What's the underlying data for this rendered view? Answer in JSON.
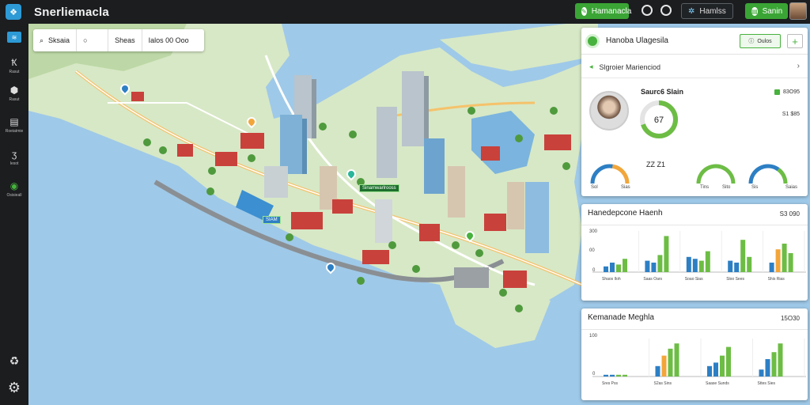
{
  "topbar": {
    "app_title": "Snerliemacla",
    "btn_primary": "Hamanacla",
    "btn_secondary": "Hamlss",
    "btn_third": "Sanin"
  },
  "rail": {
    "items": [
      {
        "glyph": "≋",
        "label": ""
      },
      {
        "glyph": "Ҟ",
        "label": "Rasut"
      },
      {
        "glyph": "⬢",
        "label": "Rasut"
      },
      {
        "glyph": "▤",
        "label": "Roeiatmie"
      },
      {
        "glyph": "ӡ",
        "label": "Iesot"
      },
      {
        "glyph": "◉",
        "label": "Osisieall"
      }
    ],
    "bottom_icons": [
      "recycle-icon",
      "gear-icon"
    ]
  },
  "search": {
    "seg1": "Sksaia",
    "seg2": "Sheas",
    "seg3": "Ialos 00 Ooo"
  },
  "map_chips": [
    "Sinamwarlrooss",
    "SIAM"
  ],
  "card1": {
    "title": "Hanoba Ulagesila",
    "btn_label": "Oulos",
    "subtitle": "Slgroier Marienciod",
    "person_name": "Saurc6 Slain",
    "stats": [
      "83O95",
      "S1 $85"
    ],
    "donut_value": "67",
    "donut_fraction": 0.7,
    "mid_value": "ZZ Z1",
    "gauges": [
      {
        "left": "Sol",
        "right": "Sias",
        "fraction": 0.55,
        "color": "#2d7fc4",
        "accent": "#f2a63a"
      },
      {
        "left": "Tins",
        "right": "Sito",
        "fraction": 0.6,
        "color": "#6dbd45",
        "accent": "#6dbd45"
      },
      {
        "left": "Sis",
        "right": "Saias",
        "fraction": 0.7,
        "color": "#2d7fc4",
        "accent": "#6dbd45"
      }
    ]
  },
  "card2": {
    "title": "Hanedepcone Haenh",
    "value": "S3 090",
    "y_top": "300",
    "y_mid": "00",
    "y_zero": "0",
    "groups": [
      {
        "label": "Shaos Iloh",
        "bars": [
          0.15,
          0.25,
          0.2,
          0.35
        ]
      },
      {
        "label": "Saas Oars",
        "bars": [
          0.3,
          0.25,
          0.45,
          0.95
        ]
      },
      {
        "label": "Soao Sias",
        "bars": [
          0.4,
          0.35,
          0.3,
          0.55
        ]
      },
      {
        "label": "Sloo Sees",
        "bars": [
          0.3,
          0.25,
          0.85,
          0.4
        ]
      },
      {
        "label": "Shis Rias",
        "bars": [
          0.25,
          0.6,
          0.75,
          0.5
        ]
      }
    ]
  },
  "card3": {
    "title": "Kemanade Meghla",
    "value": "15O30",
    "y_top": "100",
    "y_zero": "0",
    "groups": [
      {
        "label": "Sres Pss",
        "bars": [
          0.05,
          0.05,
          0.05,
          0.05
        ]
      },
      {
        "label": "S2as Sins",
        "bars": [
          0.3,
          0.6,
          0.8,
          0.95
        ]
      },
      {
        "label": "Saase Sunds",
        "bars": [
          0.3,
          0.4,
          0.6,
          0.85
        ]
      },
      {
        "label": "Sttes Sies",
        "bars": [
          0.2,
          0.5,
          0.7,
          0.95
        ]
      }
    ]
  },
  "colors": {
    "green": "#6dbd45",
    "blue": "#2d7fc4",
    "orange": "#f2a63a",
    "water": "#9fc9e8",
    "land": "#cfe3bf"
  }
}
